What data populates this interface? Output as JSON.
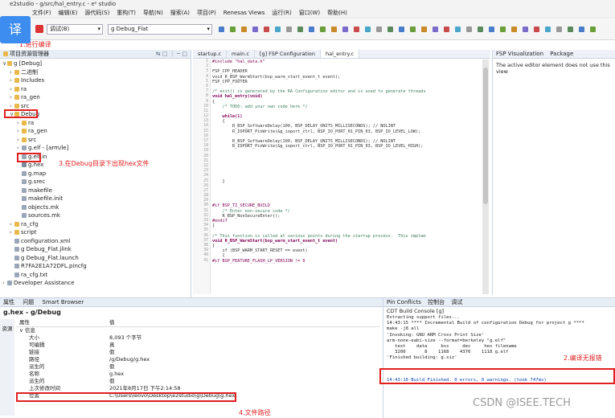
{
  "window": {
    "title": "e2studio - g/src/hal_entry.c - e² studio"
  },
  "menu": [
    "文件(F)",
    "编辑(E)",
    "源代码(S)",
    "重构(T)",
    "导航(N)",
    "搜索(A)",
    "项目(P)",
    "Renesas Views",
    "运行(R)",
    "窗口(W)",
    "帮助(H)"
  ],
  "toolbar": {
    "mode_combo": "调试(B)",
    "config_combo": "g Debug_Flat",
    "translate_badge": "译"
  },
  "annotations": {
    "step1": "1.进行编译",
    "step2": "2.编译无报错",
    "step3": "3.在Debug目录下出现hex文件",
    "step4": "4.文件路径"
  },
  "project_explorer": {
    "title": "项目资源管理器",
    "items": [
      {
        "indent": 0,
        "arrow": "∨",
        "icon": "folder",
        "label": "g [Debug]"
      },
      {
        "indent": 1,
        "arrow": "›",
        "icon": "folder",
        "label": "二进制"
      },
      {
        "indent": 1,
        "arrow": "›",
        "icon": "folder",
        "label": "Includes"
      },
      {
        "indent": 1,
        "arrow": "›",
        "icon": "folder",
        "label": "ra"
      },
      {
        "indent": 1,
        "arrow": "›",
        "icon": "folder",
        "label": "ra_gen"
      },
      {
        "indent": 1,
        "arrow": "›",
        "icon": "folder",
        "label": "src"
      },
      {
        "indent": 1,
        "arrow": "∨",
        "icon": "folder",
        "label": "Debug"
      },
      {
        "indent": 2,
        "arrow": "›",
        "icon": "folder",
        "label": "ra"
      },
      {
        "indent": 2,
        "arrow": "›",
        "icon": "folder",
        "label": "ra_gen"
      },
      {
        "indent": 2,
        "arrow": "›",
        "icon": "folder",
        "label": "src"
      },
      {
        "indent": 2,
        "arrow": "›",
        "icon": "file",
        "label": "g.elf - [arm/le]"
      },
      {
        "indent": 2,
        "arrow": "",
        "icon": "file",
        "label": "g.elf.in"
      },
      {
        "indent": 2,
        "arrow": "",
        "icon": "hexf",
        "label": "g.hex"
      },
      {
        "indent": 2,
        "arrow": "",
        "icon": "file",
        "label": "g.map"
      },
      {
        "indent": 2,
        "arrow": "",
        "icon": "file",
        "label": "g.srec"
      },
      {
        "indent": 2,
        "arrow": "",
        "icon": "file",
        "label": "makefile"
      },
      {
        "indent": 2,
        "arrow": "",
        "icon": "file",
        "label": "makefile.init"
      },
      {
        "indent": 2,
        "arrow": "",
        "icon": "file",
        "label": "objects.mk"
      },
      {
        "indent": 2,
        "arrow": "",
        "icon": "file",
        "label": "sources.mk"
      },
      {
        "indent": 1,
        "arrow": "›",
        "icon": "folder",
        "label": "ra_cfg"
      },
      {
        "indent": 1,
        "arrow": "›",
        "icon": "folder",
        "label": "script"
      },
      {
        "indent": 1,
        "arrow": "",
        "icon": "file",
        "label": "configuration.xml"
      },
      {
        "indent": 1,
        "arrow": "",
        "icon": "file",
        "label": "g Debug_Flat.jlink"
      },
      {
        "indent": 1,
        "arrow": "",
        "icon": "file",
        "label": "g Debug_Flat.launch"
      },
      {
        "indent": 1,
        "arrow": "",
        "icon": "file",
        "label": "R7FA2E1A72DFL.pincfg"
      },
      {
        "indent": 1,
        "arrow": "",
        "icon": "file",
        "label": "ra_cfg.txt"
      },
      {
        "indent": 0,
        "arrow": "›",
        "icon": "file",
        "label": "Developer Assistance"
      }
    ]
  },
  "editor": {
    "tabs": [
      {
        "label": "startup.c",
        "active": false
      },
      {
        "label": "main.c",
        "active": false
      },
      {
        "label": "[g] FSP Configuration",
        "active": false
      },
      {
        "label": "hal_entry.c",
        "active": true
      }
    ],
    "lines": [
      {
        "n": "1",
        "t": "#include \"hal_data.h\"",
        "c": "pp"
      },
      {
        "n": "2",
        "t": "",
        "c": ""
      },
      {
        "n": "3",
        "t": "FSP_CPP_HEADER",
        "c": ""
      },
      {
        "n": "4",
        "t": "void R_BSP_WarmStart(bsp_warm_start_event_t event);",
        "c": ""
      },
      {
        "n": "5",
        "t": "FSP_CPP_FOOTER",
        "c": ""
      },
      {
        "n": "6",
        "t": "",
        "c": ""
      },
      {
        "n": "7",
        "t": "/* exit() is generated by the RA Configuration editor and is used to generate threads",
        "c": "cm"
      },
      {
        "n": "8",
        "t": "void hal_entry(void)",
        "c": "kw"
      },
      {
        "n": "9",
        "t": "{",
        "c": ""
      },
      {
        "n": "10",
        "t": "    /* TODO: add your own code here */",
        "c": "cm"
      },
      {
        "n": "11",
        "t": "",
        "c": ""
      },
      {
        "n": "12",
        "t": "    while(1)",
        "c": "kw"
      },
      {
        "n": "13",
        "t": "    {",
        "c": ""
      },
      {
        "n": "14",
        "t": "        R_BSP_SoftwareDelay(100, BSP_DELAY_UNITS_MILLISECONDS); // NOLINT",
        "c": ""
      },
      {
        "n": "15",
        "t": "        R_IOPORT_PinWrite(&g_ioport_ctrl, BSP_IO_PORT_01_PIN_03, BSP_IO_LEVEL_LOW);",
        "c": ""
      },
      {
        "n": "16",
        "t": "",
        "c": ""
      },
      {
        "n": "17",
        "t": "        R_BSP_SoftwareDelay(100, BSP_DELAY_UNITS_MILLISECONDS); // NOLINT",
        "c": ""
      },
      {
        "n": "18",
        "t": "        R_IOPORT_PinWrite(&g_ioport_ctrl, BSP_IO_PORT_01_PIN_03, BSP_IO_LEVEL_HIGH);",
        "c": ""
      },
      {
        "n": "19",
        "t": "",
        "c": ""
      },
      {
        "n": "20",
        "t": "",
        "c": ""
      },
      {
        "n": "21",
        "t": "",
        "c": ""
      },
      {
        "n": "22",
        "t": "",
        "c": ""
      },
      {
        "n": "23",
        "t": "",
        "c": ""
      },
      {
        "n": "24",
        "t": "",
        "c": ""
      },
      {
        "n": "25",
        "t": "    }",
        "c": ""
      },
      {
        "n": "26",
        "t": "",
        "c": ""
      },
      {
        "n": "27",
        "t": "",
        "c": ""
      },
      {
        "n": "28",
        "t": "",
        "c": ""
      },
      {
        "n": "29",
        "t": "",
        "c": ""
      },
      {
        "n": "30",
        "t": "#if BSP_TZ_SECURE_BUILD",
        "c": "pp"
      },
      {
        "n": "31",
        "t": "    /* Enter non-secure code */",
        "c": "cm"
      },
      {
        "n": "32",
        "t": "    R_BSP_NonSecureEnter();",
        "c": ""
      },
      {
        "n": "33",
        "t": "#endif",
        "c": "pp"
      },
      {
        "n": "34",
        "t": "}",
        "c": ""
      },
      {
        "n": "35",
        "t": "",
        "c": ""
      },
      {
        "n": "36",
        "t": "/* This function is called at various points during the startup process.  This implem",
        "c": "cm"
      },
      {
        "n": "37",
        "t": "void R_BSP_WarmStart(bsp_warm_start_event_t event)",
        "c": "kw"
      },
      {
        "n": "38",
        "t": "{",
        "c": ""
      },
      {
        "n": "39",
        "t": "    if (BSP_WARM_START_RESET == event)",
        "c": ""
      },
      {
        "n": "40",
        "t": "    {",
        "c": ""
      },
      {
        "n": "41",
        "t": "#if BSP_FEATURE_FLASH_LP_VERSION != 0",
        "c": "pp"
      }
    ]
  },
  "right_panel": {
    "tabs": [
      "FSP Visualization",
      "Package"
    ],
    "message": "The active editor element does not use this view"
  },
  "properties": {
    "tabs": [
      "属性",
      "问题",
      "Smart Browser"
    ],
    "title": "g.hex - g/Debug",
    "side_tab": "资源",
    "col_property": "属性",
    "col_value": "值",
    "group": "信息",
    "rows": [
      {
        "key": "大小",
        "value": "8,093 个字节"
      },
      {
        "key": "可编辑",
        "value": "真"
      },
      {
        "key": "链接",
        "value": "假"
      },
      {
        "key": "路径",
        "value": "/g/Debug/g.hex"
      },
      {
        "key": "派生的",
        "value": "假"
      },
      {
        "key": "名称",
        "value": "g.hex"
      },
      {
        "key": "派生的",
        "value": "假"
      },
      {
        "key": "上次修改时间",
        "value": "2021年8月17日 下午2:14:58"
      },
      {
        "key": "位置",
        "value": "C:\\Users\\leovo\\Desktop\\e2studio\\g\\Debug\\g.hex"
      }
    ]
  },
  "console": {
    "tabs": [
      "Pin Conflicts",
      "控制台",
      "调试"
    ],
    "title": "CDT Build Console [g]",
    "lines": [
      "Extracting support files...",
      "14:43:15 **** Incremental Build of configuration Debug for project g ****",
      "make -j8 all",
      "'Invoking: GNU ARM Cross Print Size'",
      "arm-none-eabi-size --format=berkeley \"g.elf\"",
      "   text    data     bss     dec     hex filename",
      "   3200       8    1168    4376    1118 g.elf",
      "'Finished building: g.siz'",
      " ",
      " "
    ],
    "result": "14:43:16 Build Finished. 0 errors, 0 warnings. (took 747ms)"
  },
  "watermark": "CSDN @ISEE.TECH",
  "colors": {
    "annotation_red": "#e02020",
    "badge_blue": "#3d8cf0",
    "keyword": "#7f0055",
    "comment": "#3f7f5f"
  }
}
